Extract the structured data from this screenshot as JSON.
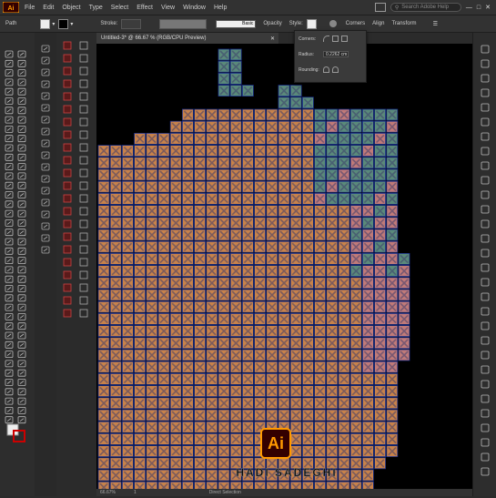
{
  "app": {
    "name": "Adobe Illustrator",
    "logo_text": "Ai"
  },
  "menubar": {
    "items": [
      "File",
      "Edit",
      "Object",
      "Type",
      "Select",
      "Effect",
      "View",
      "Window",
      "Help"
    ],
    "search_placeholder": "Search Adobe Help"
  },
  "control_bar": {
    "path_label": "Path",
    "stroke_label": "Stroke:",
    "brush_label": "Basic",
    "opacity_label": "Opacity",
    "style_label": "Style:",
    "corners_label": "Corners",
    "align_label": "Align",
    "transform_label": "Transform"
  },
  "document_tab": {
    "title": "Untitled-3* @ 66.67 % (RGB/CPU Preview)"
  },
  "corners_popup": {
    "corners_label": "Corners:",
    "radius_label": "Radius:",
    "radius_value": "0.2262 cm",
    "rounding_label": "Rounding:"
  },
  "status_bar": {
    "zoom": "66.67%",
    "page": "1",
    "tool": "Direct Selection"
  },
  "watermark": {
    "logo": "Ai",
    "name": "HADI SADEGHI"
  },
  "colors": {
    "orange": "#c8824a",
    "teal": "#5a8a7a",
    "pink": "#c07a78",
    "outline": "#1a2f8a",
    "canvas": "#000000",
    "accent": "#ff9a00"
  },
  "icons": [
    "selection-tool-icon",
    "direct-selection-tool-icon",
    "pen-tool-icon",
    "type-tool-icon",
    "rectangle-tool-icon",
    "zoom-tool-icon",
    "hand-tool-icon",
    "fill-stroke-icon",
    "layers-icon",
    "properties-icon",
    "swatches-icon"
  ]
}
